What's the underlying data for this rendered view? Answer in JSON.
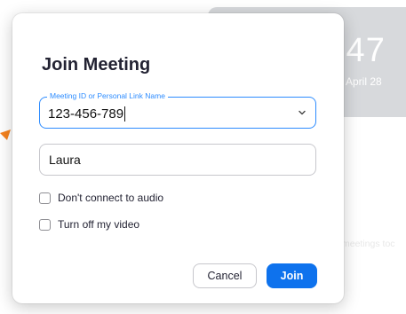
{
  "background_app": {
    "time_partial": ":47",
    "date_partial": ", April 28",
    "meetings_partial": "meetings toc"
  },
  "dialog": {
    "title": "Join Meeting",
    "meeting_id": {
      "label": "Meeting ID or Personal Link Name",
      "value": "123-456-789"
    },
    "name_field": {
      "value": "Laura"
    },
    "options": [
      {
        "label": "Don't connect to audio",
        "checked": false
      },
      {
        "label": "Turn off my video",
        "checked": false
      }
    ],
    "buttons": {
      "cancel": "Cancel",
      "join": "Join"
    }
  },
  "colors": {
    "accent": "#2d8cff",
    "join_button": "#0e72ed",
    "pointer": "#f5821f"
  },
  "icons": {
    "meeting_dropdown": "chevron-down-icon",
    "pointer": "arrow-pointer-icon"
  }
}
